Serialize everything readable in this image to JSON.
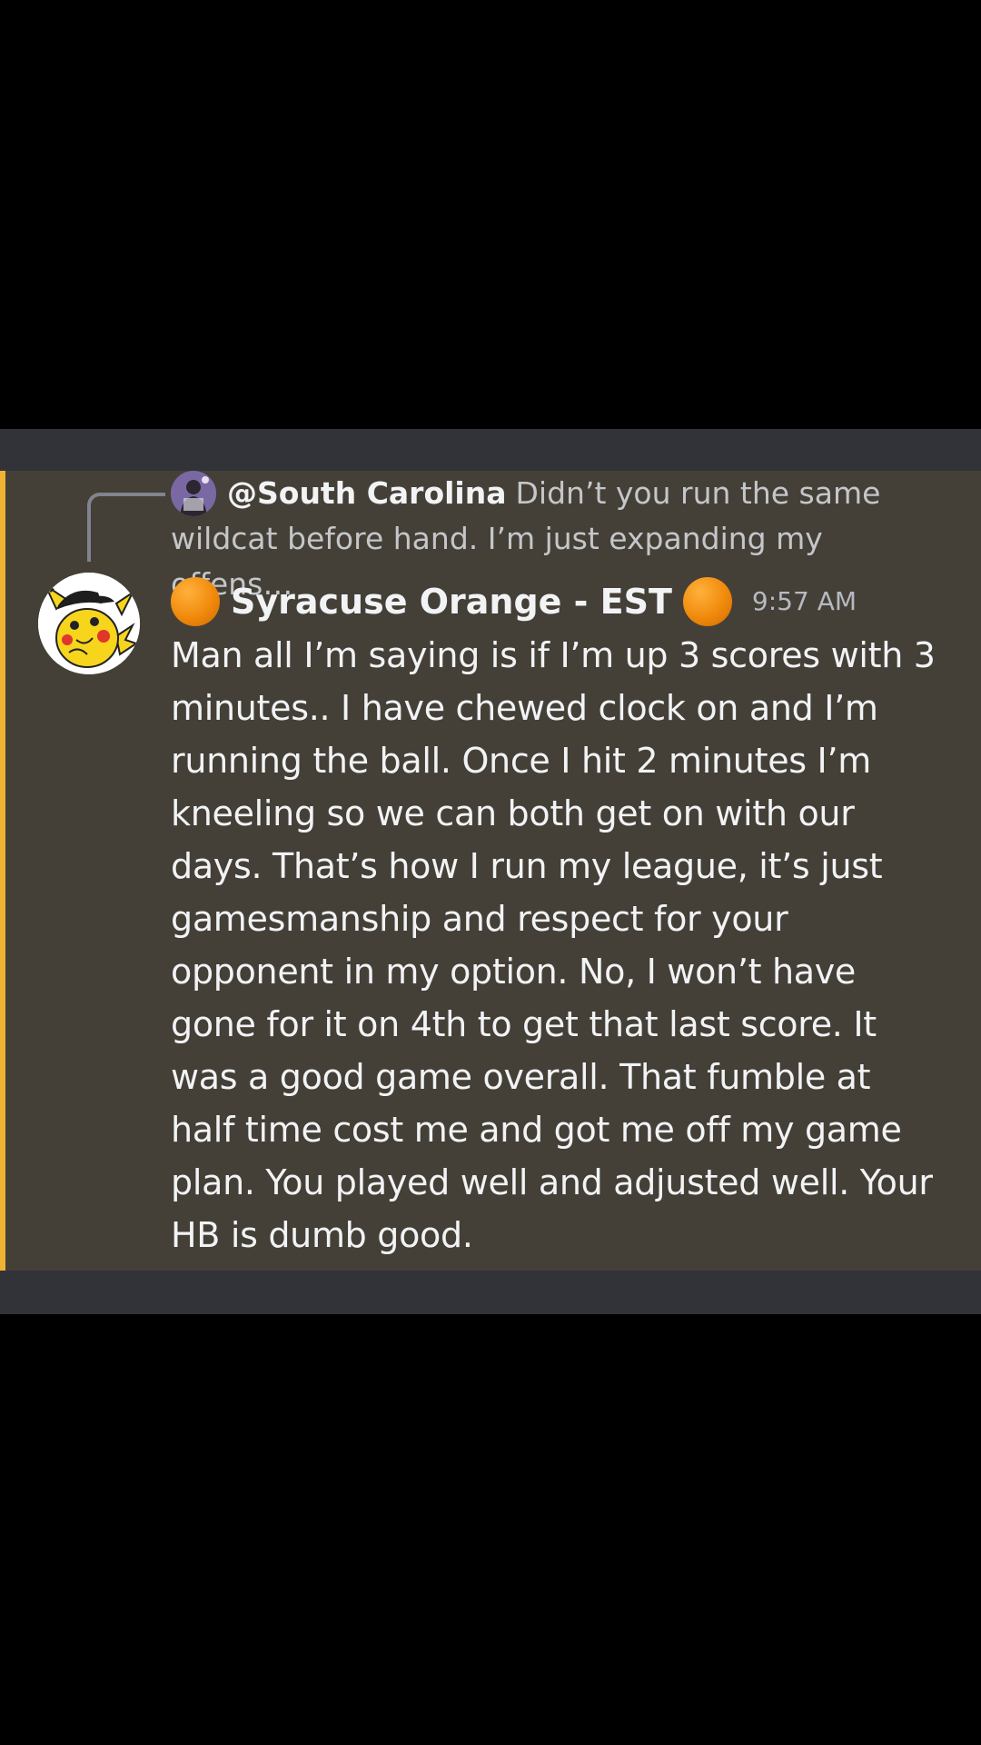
{
  "reply": {
    "author": "@South Carolina",
    "preview": "Didn’t you run the same wildcat before hand. I’m just expanding my offens…"
  },
  "message": {
    "username": "Syracuse Orange - EST",
    "timestamp": "9:57 AM",
    "text": "Man all I’m saying is if I’m up 3 scores with 3 minutes.. I have chewed clock on and I’m running the ball. Once I hit 2 minutes I’m kneeling so we can both get on with our days. That’s how I run my league, it’s just gamesmanship and respect for your opponent in my option. No, I won’t have gone for it on 4th to get that last score. It was a good game overall. That fumble at half time cost me and got me off my game plan. You played well and adjusted well. Your HB is dumb good."
  },
  "icons": {
    "reply_avatar": "user-avatar-icon",
    "author_avatar": "pikachu-avatar-icon",
    "decoration": "orange-ball-icon"
  },
  "colors": {
    "mention_highlight": "#444038",
    "mention_bar": "#f0b232",
    "background": "#000000",
    "channel_background": "#313338"
  }
}
